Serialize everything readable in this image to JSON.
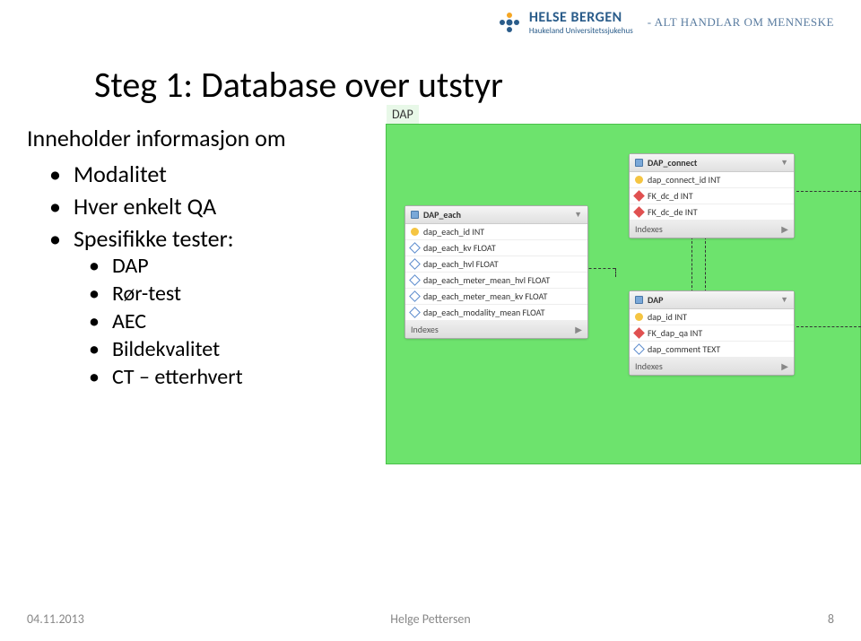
{
  "logo": {
    "main": "HELSE BERGEN",
    "sub": "Haukeland Universitetssjukehus",
    "tagline": "- ALT HANDLAR OM MENNESKE"
  },
  "title": "Steg 1: Database over utstyr",
  "lead": "Inneholder informasjon om",
  "bullets": [
    "Modalitet",
    "Hver enkelt QA",
    "Spesifikke tester:"
  ],
  "subbullets": [
    "DAP",
    "Rør-test",
    "AEC",
    "Bildekvalitet",
    "CT – etterhvert"
  ],
  "diagram": {
    "tab": "DAP",
    "tables": {
      "dap_each": {
        "name": "DAP_each",
        "rows": [
          {
            "icon": "key",
            "label": "dap_each_id INT"
          },
          {
            "icon": "col",
            "label": "dap_each_kv FLOAT"
          },
          {
            "icon": "col",
            "label": "dap_each_hvl FLOAT"
          },
          {
            "icon": "col",
            "label": "dap_each_meter_mean_hvl FLOAT"
          },
          {
            "icon": "col",
            "label": "dap_each_meter_mean_kv FLOAT"
          },
          {
            "icon": "col",
            "label": "dap_each_modality_mean FLOAT"
          }
        ],
        "indexes": "Indexes"
      },
      "dap_connect": {
        "name": "DAP_connect",
        "rows": [
          {
            "icon": "key",
            "label": "dap_connect_id INT"
          },
          {
            "icon": "fk",
            "label": "FK_dc_d INT"
          },
          {
            "icon": "fk",
            "label": "FK_dc_de INT"
          }
        ],
        "indexes": "Indexes"
      },
      "dap": {
        "name": "DAP",
        "rows": [
          {
            "icon": "key",
            "label": "dap_id INT"
          },
          {
            "icon": "fk",
            "label": "FK_dap_qa INT"
          },
          {
            "icon": "col",
            "label": "dap_comment TEXT"
          }
        ],
        "indexes": "Indexes"
      }
    }
  },
  "footer": {
    "date": "04.11.2013",
    "author": "Helge Pettersen",
    "page": "8"
  }
}
